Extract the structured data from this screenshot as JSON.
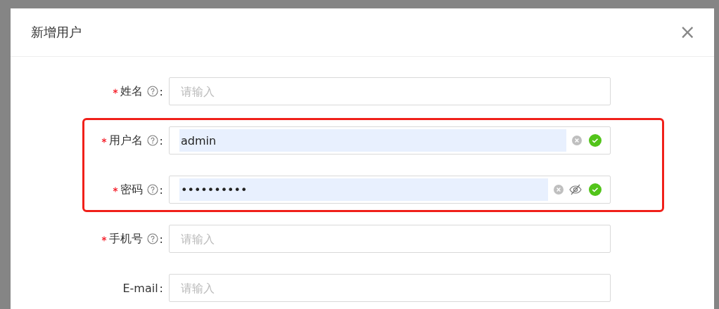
{
  "dialog": {
    "title": "新增用户",
    "close": "×"
  },
  "fields": [
    {
      "label": "姓名",
      "colon": ":",
      "required": true,
      "help": true,
      "kind": "text",
      "placeholder": "请输入",
      "autofilled": false,
      "valid": false,
      "highlighted": false
    },
    {
      "label": "用户名",
      "colon": ":",
      "required": true,
      "help": true,
      "kind": "text",
      "value": "admin",
      "autofilled": true,
      "valid": true,
      "highlighted": true
    },
    {
      "label": "密码",
      "colon": ":",
      "required": true,
      "help": true,
      "kind": "password",
      "value": "••••••••••",
      "autofilled": true,
      "valid": true,
      "highlighted": true
    },
    {
      "label": "手机号",
      "colon": ":",
      "required": true,
      "help": true,
      "kind": "text",
      "placeholder": "请输入",
      "autofilled": false,
      "valid": false,
      "highlighted": false
    },
    {
      "label": "E-mail",
      "colon": ":",
      "required": false,
      "help": false,
      "kind": "text",
      "placeholder": "请输入",
      "autofilled": false,
      "valid": false,
      "highlighted": false
    }
  ]
}
